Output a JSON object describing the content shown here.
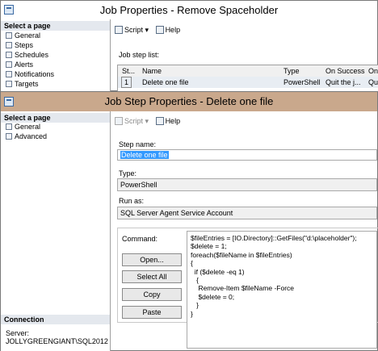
{
  "job_window": {
    "title": "Job Properties - Remove Spaceholder",
    "select_page_header": "Select a page",
    "pages": [
      "General",
      "Steps",
      "Schedules",
      "Alerts",
      "Notifications",
      "Targets"
    ],
    "toolbar": {
      "script": "Script",
      "help": "Help"
    },
    "step_list_label": "Job step list:",
    "columns": [
      "St...",
      "Name",
      "Type",
      "On Success",
      "On"
    ],
    "rows": [
      {
        "step": "1",
        "name": "Delete one file",
        "type": "PowerShell",
        "on_success": "Quit the j...",
        "on_failure": "Qu"
      }
    ]
  },
  "step_window": {
    "title": "Job Step Properties - Delete one file",
    "select_page_header": "Select a page",
    "pages": [
      "General",
      "Advanced"
    ],
    "toolbar": {
      "script": "Script",
      "help": "Help"
    },
    "step_name_label": "Step name:",
    "step_name_value": "Delete one file",
    "type_label": "Type:",
    "type_value": "PowerShell",
    "run_as_label": "Run as:",
    "run_as_value": "SQL Server Agent Service Account",
    "command_label": "Command:",
    "buttons": {
      "open": "Open...",
      "select_all": "Select All",
      "copy": "Copy",
      "paste": "Paste"
    },
    "command_text": "$fileEntries = [IO.Directory]::GetFiles(\"d:\\placeholder\");\n$delete = 1;\nforeach($fileName in $fileEntries)\n{\n  if ($delete -eq 1)\n   {\n    Remove-Item $fileName -Force\n    $delete = 0;\n   }\n}",
    "connection_header": "Connection",
    "server_label": "Server:",
    "server_value": "JOLLYGREENGIANT\\SQL2012"
  },
  "colors": {
    "title_tan": "#c9a88c",
    "title_white": "#ffffff",
    "selection_blue": "#3399ff"
  }
}
